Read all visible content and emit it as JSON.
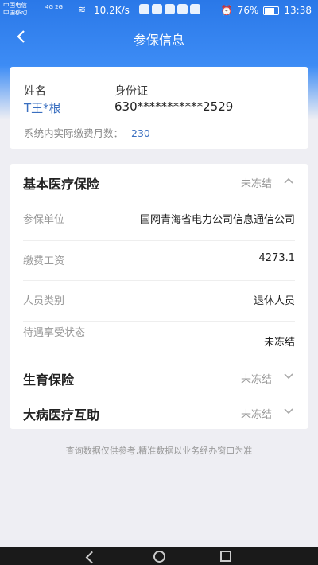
{
  "status_bar": {
    "carrier1": "中国电信",
    "carrier2": "中国移动",
    "network": "4G 2G",
    "speed": "10.2K/s",
    "battery": "76%",
    "time": "13:38"
  },
  "nav": {
    "title": "参保信息",
    "back_icon": "chevron-left-icon"
  },
  "person": {
    "name_label": "姓名",
    "name_value": "T王*根",
    "id_label": "身份证",
    "id_value": "630***********2529",
    "months_label": "系统内实际缴费月数：",
    "months_value": "230"
  },
  "sections": [
    {
      "title": "基本医疗保险",
      "status": "未冻结",
      "expanded": true,
      "rows": [
        {
          "label": "参保单位",
          "value": "国网青海省电力公司信息通信公司"
        },
        {
          "label": "缴费工资",
          "value": "4273.1"
        },
        {
          "label": "人员类别",
          "value": "退休人员"
        },
        {
          "label": "待遇享受状态",
          "value": "未冻结"
        }
      ]
    },
    {
      "title": "生育保险",
      "status": "未冻结",
      "expanded": false
    },
    {
      "title": "大病医疗互助",
      "status": "未冻结",
      "expanded": false
    }
  ],
  "footnote": "查询数据仅供参考,精准数据以业务经办窗口为准",
  "colors": {
    "header": "#2a78e8",
    "accent_text": "#3a6fc0",
    "background": "#eeeef3"
  }
}
